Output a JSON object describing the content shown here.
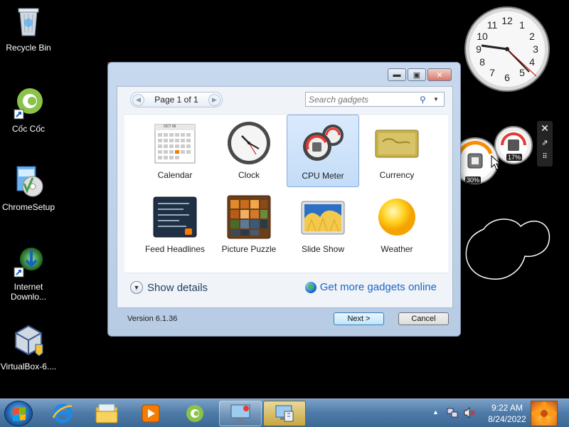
{
  "desktop_icons": [
    {
      "label": "Recycle Bin"
    },
    {
      "label": "Cốc Cốc"
    },
    {
      "label": "ChromeSetup"
    },
    {
      "label": "Internet Downlo..."
    },
    {
      "label": "VirtualBox-6...."
    }
  ],
  "cpu_gadget": {
    "cpu_percent": "30%",
    "memory_percent": "17%"
  },
  "calendar_thumb": {
    "month": "OCT 06"
  },
  "gadget_gallery": {
    "pager": "Page 1 of 1",
    "search_placeholder": "Search gadgets",
    "gadgets": [
      {
        "label": "Calendar"
      },
      {
        "label": "Clock"
      },
      {
        "label": "CPU Meter",
        "selected": true
      },
      {
        "label": "Currency"
      },
      {
        "label": "Feed Headlines"
      },
      {
        "label": "Picture Puzzle"
      },
      {
        "label": "Slide Show"
      },
      {
        "label": "Weather"
      }
    ],
    "show_details": "Show details",
    "get_more": "Get more gadgets online",
    "version": "Version 6.1.36",
    "next_label": "Next >",
    "cancel_label": "Cancel"
  },
  "taskbar": {
    "time": "9:22 AM",
    "date": "8/24/2022"
  },
  "colors": {
    "accent": "#1a66c4",
    "selection": "#c3dcf8",
    "taskbar": "#4d7aa8"
  }
}
